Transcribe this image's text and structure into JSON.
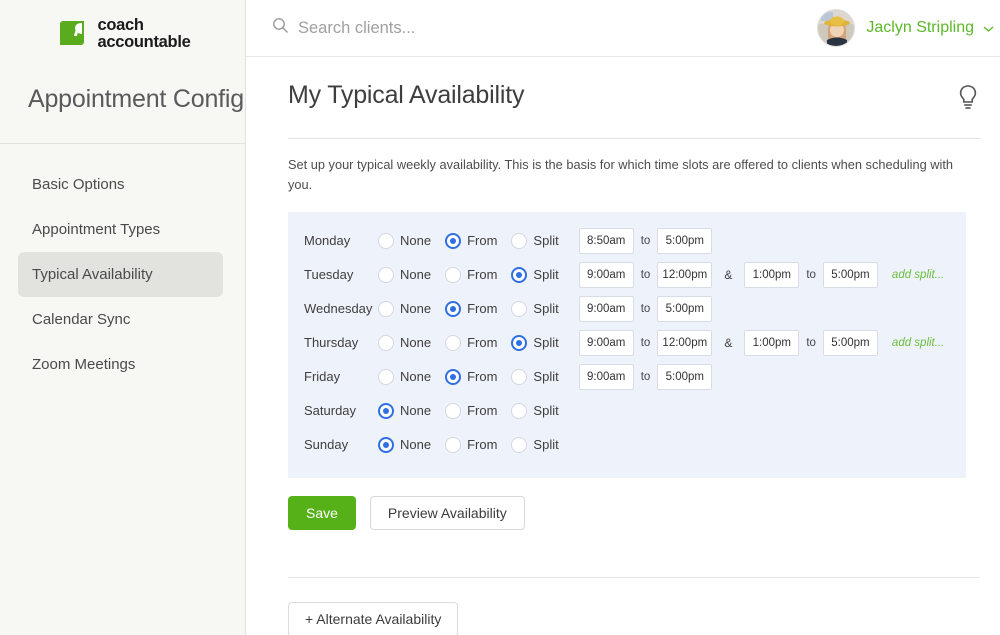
{
  "sidebar": {
    "logo": {
      "icon": "leaf-logo-icon",
      "line1": "coach",
      "line2": "accountable",
      "color": "#5aab1e"
    },
    "title": "Appointment Config",
    "items": [
      {
        "label": "Basic Options",
        "active": false
      },
      {
        "label": "Appointment Types",
        "active": false
      },
      {
        "label": "Typical Availability",
        "active": true
      },
      {
        "label": "Calendar Sync",
        "active": false
      },
      {
        "label": "Zoom Meetings",
        "active": false
      }
    ]
  },
  "topbar": {
    "search": {
      "icon": "search-icon",
      "placeholder": "Search clients...",
      "value": ""
    },
    "user": {
      "name": "Jaclyn Stripling",
      "avatar": "user-avatar",
      "chevron": "⌄",
      "color": "#5cb82a"
    }
  },
  "page": {
    "title": "My Typical Availability",
    "help_icon": "lightbulb-icon",
    "intro": "Set up your typical weekly availability. This is the basis for which time slots are offered to clients when scheduling with you."
  },
  "availability": {
    "options": [
      "None",
      "From",
      "Split"
    ],
    "to_label": "to",
    "amp_label": "&",
    "add_split_label": "add split...",
    "rows": [
      {
        "day": "Monday",
        "mode": "From",
        "start": "8:50am",
        "end": "5:00pm",
        "split_start": "",
        "split_end": ""
      },
      {
        "day": "Tuesday",
        "mode": "Split",
        "start": "9:00am",
        "end": "12:00pm",
        "split_start": "1:00pm",
        "split_end": "5:00pm"
      },
      {
        "day": "Wednesday",
        "mode": "From",
        "start": "9:00am",
        "end": "5:00pm",
        "split_start": "",
        "split_end": ""
      },
      {
        "day": "Thursday",
        "mode": "Split",
        "start": "9:00am",
        "end": "12:00pm",
        "split_start": "1:00pm",
        "split_end": "5:00pm"
      },
      {
        "day": "Friday",
        "mode": "From",
        "start": "9:00am",
        "end": "5:00pm",
        "split_start": "",
        "split_end": ""
      },
      {
        "day": "Saturday",
        "mode": "None",
        "start": "",
        "end": "",
        "split_start": "",
        "split_end": ""
      },
      {
        "day": "Sunday",
        "mode": "None",
        "start": "",
        "end": "",
        "split_start": "",
        "split_end": ""
      }
    ]
  },
  "actions": {
    "save_label": "Save",
    "preview_label": "Preview Availability",
    "alternate_label": "+ Alternate Availability"
  }
}
